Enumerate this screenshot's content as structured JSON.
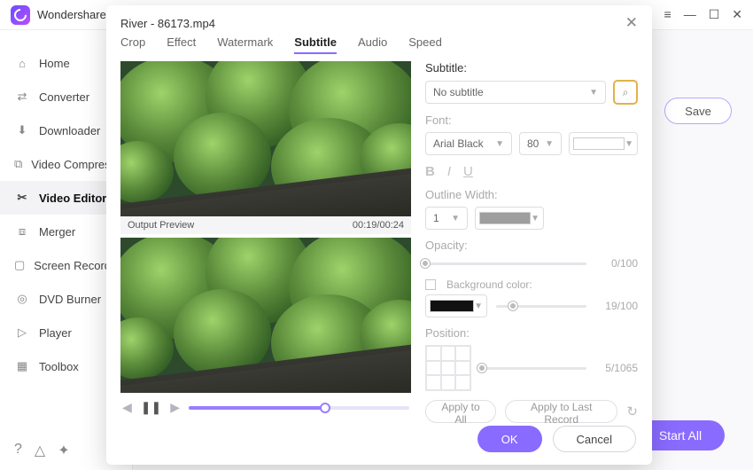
{
  "brand": "Wondershare UniConverter",
  "titlebar_icons": {
    "menu": "≡",
    "min": "—",
    "max": "☐",
    "close": "✕"
  },
  "sidebar": {
    "items": [
      {
        "id": "home",
        "label": "Home"
      },
      {
        "id": "converter",
        "label": "Converter"
      },
      {
        "id": "downloader",
        "label": "Downloader"
      },
      {
        "id": "video-compressor",
        "label": "Video Compressor"
      },
      {
        "id": "video-editor",
        "label": "Video Editor",
        "active": true
      },
      {
        "id": "merger",
        "label": "Merger"
      },
      {
        "id": "screen-recorder",
        "label": "Screen Recorder"
      },
      {
        "id": "dvd-burner",
        "label": "DVD Burner"
      },
      {
        "id": "player",
        "label": "Player"
      },
      {
        "id": "toolbox",
        "label": "Toolbox"
      }
    ]
  },
  "content": {
    "save": "Save",
    "start_all": "Start All"
  },
  "modal": {
    "title": "River - 86173.mp4",
    "tabs": [
      "Crop",
      "Effect",
      "Watermark",
      "Subtitle",
      "Audio",
      "Speed"
    ],
    "active_tab": "Subtitle",
    "preview": {
      "label": "Output Preview",
      "time": "00:19/00:24"
    },
    "subtitle": {
      "heading": "Subtitle:",
      "selected": "No subtitle",
      "font_label": "Font:",
      "font": "Arial Black",
      "size": "80",
      "outline_label": "Outline Width:",
      "outline": "1",
      "opacity_label": "Opacity:",
      "opacity_val": "0/100",
      "bg_label": "Background color:",
      "bg_val": "19/100",
      "pos_label": "Position:",
      "pos_val": "5/1065",
      "apply_all": "Apply to All",
      "apply_last": "Apply to Last Record"
    },
    "footer": {
      "ok": "OK",
      "cancel": "Cancel"
    }
  },
  "icons": {
    "home": "⌂",
    "converter": "⇄",
    "downloader": "⬇",
    "video-compressor": "⧉",
    "video-editor": "✂",
    "merger": "⧈",
    "screen-recorder": "▢",
    "dvd-burner": "◎",
    "player": "▷",
    "toolbox": "▦",
    "help": "?",
    "bell": "△",
    "promo": "✦",
    "search": "⌕",
    "prev": "◀",
    "play": "❚❚",
    "next": "▶",
    "reset": "↻"
  }
}
